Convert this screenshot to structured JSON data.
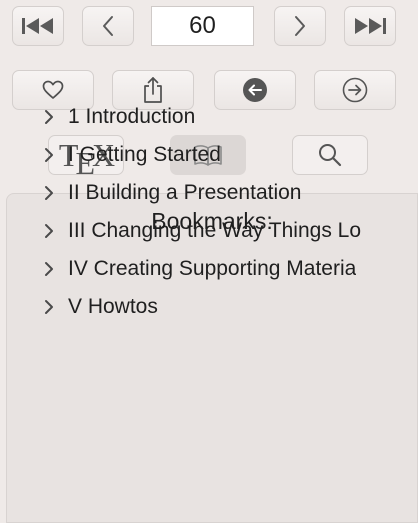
{
  "toolbar": {
    "page_number": "60",
    "first_page_icon": "skip-to-start-icon",
    "prev_page_icon": "chevron-left-icon",
    "next_page_icon": "chevron-right-icon",
    "last_page_icon": "skip-to-end-icon"
  },
  "actions": {
    "favorite_icon": "heart-icon",
    "share_icon": "share-icon",
    "back_icon": "arrow-left-circle-filled-icon",
    "forward_icon": "arrow-right-circle-icon"
  },
  "view_modes": {
    "tex_label_t": "T",
    "tex_label_e": "E",
    "tex_label_x": "X",
    "bookmarks_icon": "book-icon",
    "search_icon": "search-icon",
    "selected": "bookmarks"
  },
  "bookmarks": {
    "title": "Bookmarks:",
    "items": [
      {
        "label": "1 Introduction"
      },
      {
        "label": "I Getting Started"
      },
      {
        "label": "II Building a Presentation"
      },
      {
        "label": "III Changing the Way Things Lo"
      },
      {
        "label": "IV Creating Supporting Materia"
      },
      {
        "label": "V Howtos"
      }
    ]
  }
}
